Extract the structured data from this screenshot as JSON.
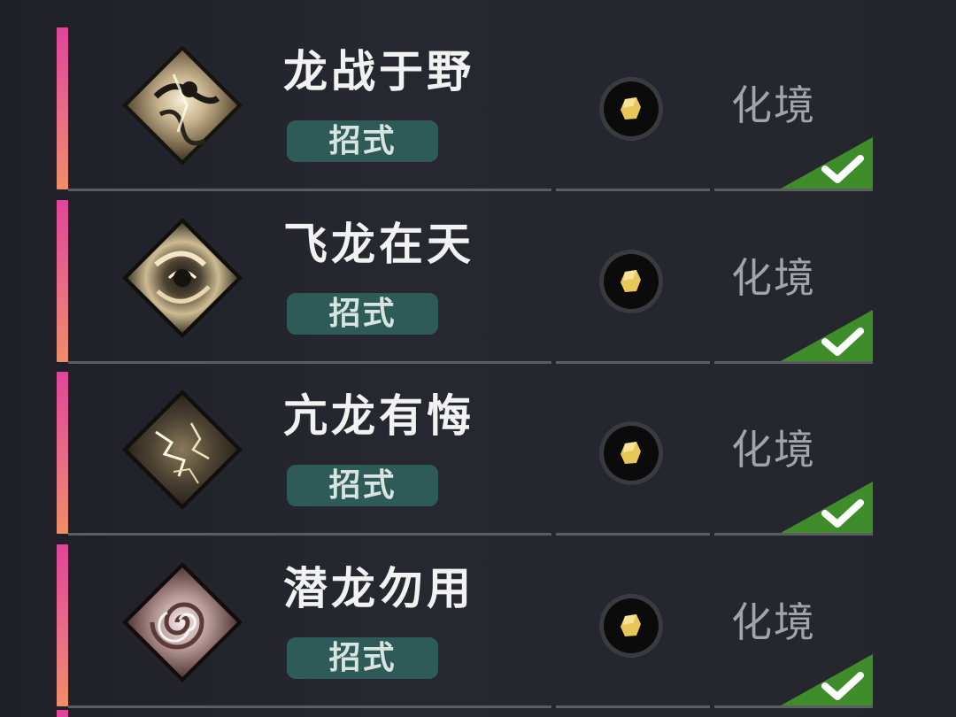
{
  "skills": [
    {
      "name": "龙战于野",
      "tag": "招式",
      "level": "化境",
      "icon": "dragon-storm-skill-icon",
      "resource_icon": "gold-nugget-icon",
      "learned": true
    },
    {
      "name": "飞龙在天",
      "tag": "招式",
      "level": "化境",
      "icon": "flying-dragon-skill-icon",
      "resource_icon": "gold-nugget-icon",
      "learned": true
    },
    {
      "name": "亢龙有悔",
      "tag": "招式",
      "level": "化境",
      "icon": "lightning-dragon-skill-icon",
      "resource_icon": "gold-nugget-icon",
      "learned": true
    },
    {
      "name": "潜龙勿用",
      "tag": "招式",
      "level": "化境",
      "icon": "swirl-dragon-skill-icon",
      "resource_icon": "gold-nugget-icon",
      "learned": true
    }
  ],
  "colors": {
    "accent_top": "#e1459a",
    "accent_bottom": "#f08d67",
    "tag_bg": "#2e5b57",
    "check_green": "#3f8d2a",
    "gold": "#e7c65a"
  }
}
